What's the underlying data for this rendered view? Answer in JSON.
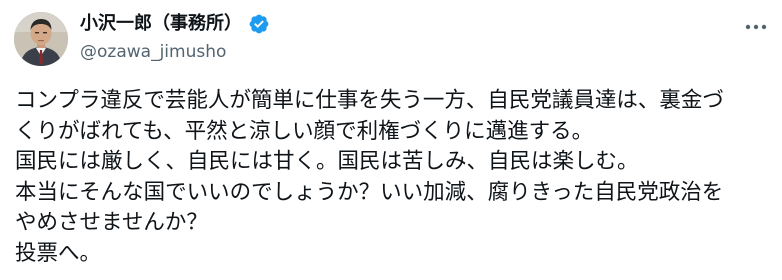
{
  "author": {
    "display_name": "小沢一郎（事務所）",
    "handle": "@ozawa_jimusho",
    "verified": true
  },
  "tweet": {
    "lines": [
      "コンプラ違反で芸能人が簡単に仕事を失う一方、自民党議員達は、裏金づ",
      "くりがばれても、平然と涼しい顔で利権づくりに邁進する。",
      "国民には厳しく、自民には甘く。国民は苦しみ、自民は楽しむ。",
      "本当にそんな国でいいのでしょうか？いい加減、腐りきった自民党政治を",
      "やめさせませんか？",
      "投票へ。"
    ]
  },
  "icons": {
    "verified": "verified-badge-icon",
    "more": "more-options-icon",
    "avatar": "profile-avatar"
  },
  "colors": {
    "text": "#0f1419",
    "secondary": "#536471",
    "verified": "#1d9bf0"
  }
}
